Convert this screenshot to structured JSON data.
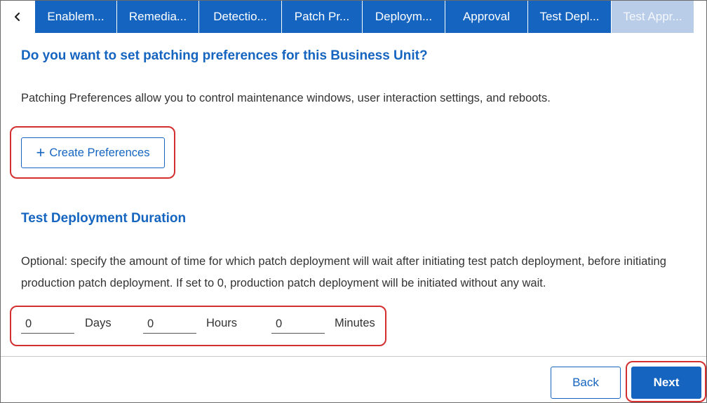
{
  "tabs": [
    {
      "label": "Enablem..."
    },
    {
      "label": "Remedia..."
    },
    {
      "label": "Detectio..."
    },
    {
      "label": "Patch Pr..."
    },
    {
      "label": "Deploym..."
    },
    {
      "label": "Approval"
    },
    {
      "label": "Test Depl..."
    },
    {
      "label": "Test Appr..."
    }
  ],
  "patching": {
    "question": "Do you want to set patching preferences for this Business Unit?",
    "description": "Patching Preferences allow you to control maintenance windows, user interaction settings, and reboots.",
    "create_button": "Create Preferences"
  },
  "duration": {
    "title": "Test Deployment Duration",
    "description": "Optional: specify the amount of time for which patch deployment will wait after initiating test patch deployment, before initiating production patch deployment. If set to 0, production patch deployment will be initiated without any wait.",
    "days_value": "0",
    "days_label": "Days",
    "hours_value": "0",
    "hours_label": "Hours",
    "minutes_value": "0",
    "minutes_label": "Minutes"
  },
  "footer": {
    "back_label": "Back",
    "next_label": "Next"
  },
  "colors": {
    "accent": "#1565c0",
    "tab_disabled": "#b9cde9",
    "highlight": "#d32f2f"
  }
}
